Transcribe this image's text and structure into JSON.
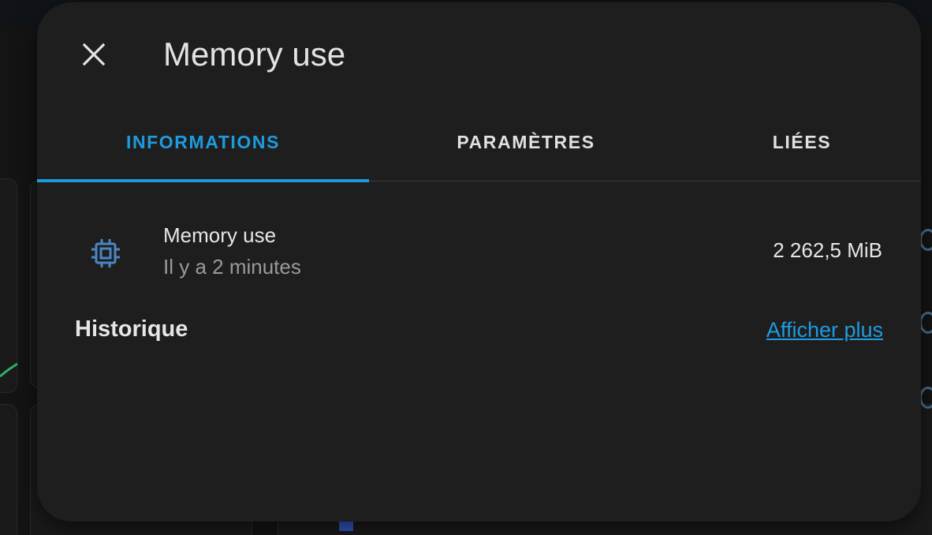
{
  "dialog": {
    "title": "Memory use",
    "close_icon": "close-icon"
  },
  "tabs": [
    {
      "label": "INFORMATIONS",
      "active": true
    },
    {
      "label": "PARAMÈTRES",
      "active": false
    },
    {
      "label": "LIÉES",
      "active": false
    }
  ],
  "entity": {
    "icon": "chip-icon",
    "name": "Memory use",
    "last_changed": "Il y a 2 minutes",
    "state": "2 262,5 MiB"
  },
  "history": {
    "title": "Historique",
    "show_more_label": "Afficher plus"
  },
  "colors": {
    "accent": "#1e9be0",
    "dialog_bg": "#1e1e1e",
    "icon_blue": "#4a86c4"
  }
}
